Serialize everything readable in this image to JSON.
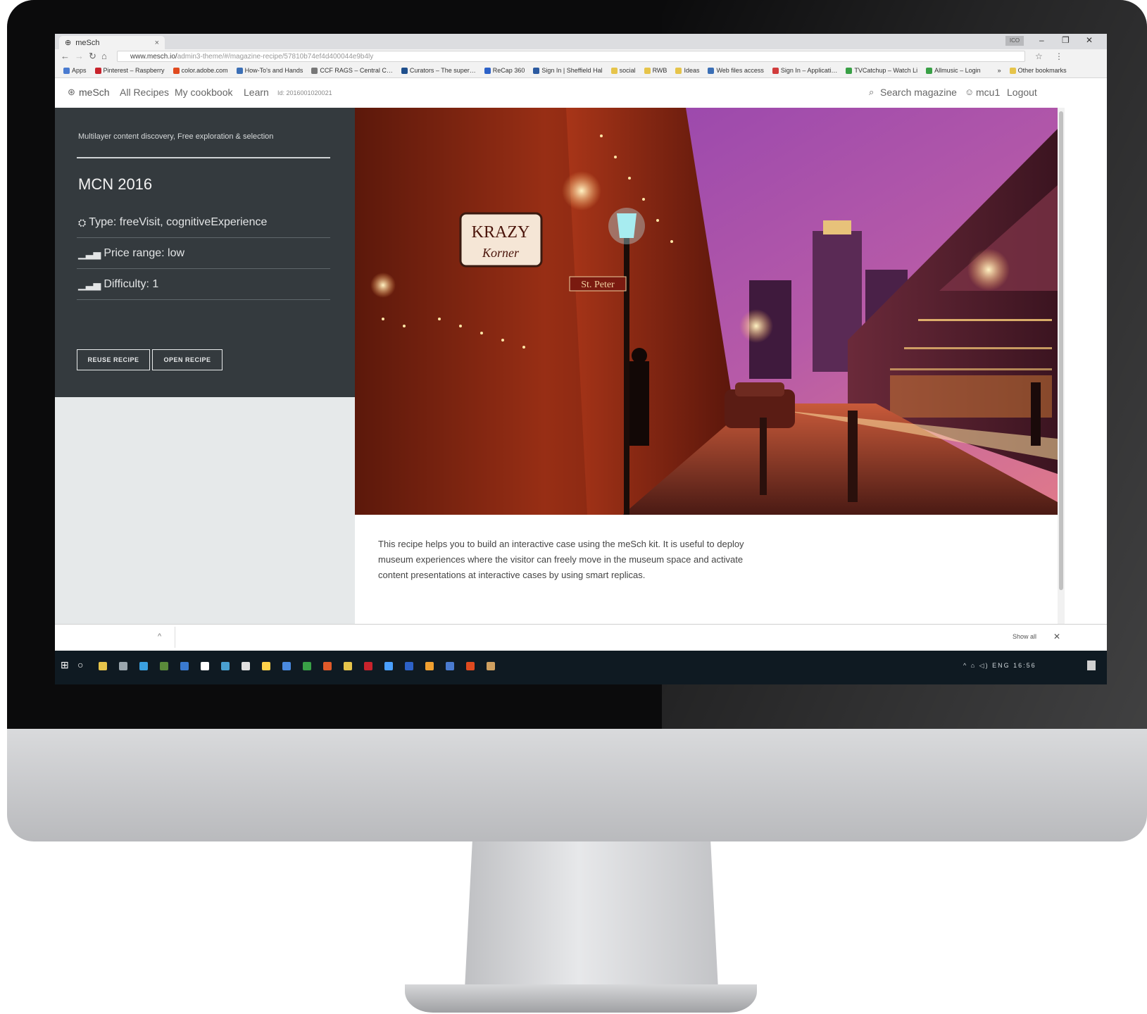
{
  "browser": {
    "tab_title": "meSch",
    "tab_close": "×",
    "window_badge": "ICO",
    "window_minimize": "–",
    "window_restore": "❐",
    "window_close": "✕",
    "url_main": "www.mesch.io/",
    "url_tail": "admin3-theme/#/magazine-recipe/57810b74ef4d400044e9b4ly",
    "bookmarks": [
      {
        "label": "Apps",
        "color": "#4a7bd0"
      },
      {
        "label": "Pinterest – Raspberry",
        "color": "#c8232c"
      },
      {
        "label": "color.adobe.com",
        "color": "#e04a1f"
      },
      {
        "label": "How-To's and Hands",
        "color": "#3b6fb6"
      },
      {
        "label": "CCF RAGS – Central C…",
        "color": "#777777"
      },
      {
        "label": "Curators – The super…",
        "color": "#1f4f8c"
      },
      {
        "label": "ReCap 360",
        "color": "#2d62c8"
      },
      {
        "label": "Sign In | Sheffield Hal",
        "color": "#2c5aa0"
      },
      {
        "label": "social",
        "color": "#e6c44a"
      },
      {
        "label": "RWB",
        "color": "#e6c44a"
      },
      {
        "label": "Ideas",
        "color": "#e6c44a"
      },
      {
        "label": "Web files access",
        "color": "#3b6fb6"
      },
      {
        "label": "Sign In – Applicati…",
        "color": "#d13c3c"
      },
      {
        "label": "TVCatchup – Watch Li",
        "color": "#39a046"
      },
      {
        "label": "Allmusic – Login",
        "color": "#39a046"
      },
      {
        "label": "»",
        "color": "transparent"
      },
      {
        "label": "Other bookmarks",
        "color": "#e6c44a"
      }
    ]
  },
  "site_nav": {
    "brand": "meSch",
    "all_recipes": "All Recipes",
    "my_cookbook": "My cookbook",
    "learn": "Learn",
    "id_text": "Id: 2016001020021",
    "search": "Search magazine",
    "user": "mcu1",
    "logout": "Logout"
  },
  "recipe": {
    "subtitle": "Multilayer content discovery, Free exploration & selection",
    "title": "MCN 2016",
    "type": "Type: freeVisit, cognitiveExperience",
    "price": "Price range: low",
    "difficulty": "Difficulty: 1",
    "reuse_label": "REUSE RECIPE",
    "open_label": "OPEN RECIPE",
    "description": "This recipe helps you to build an interactive case using the meSch kit. It is useful to deploy museum experiences where the visitor can freely move in the museum space and activate content presentations at interactive cases by using smart replicas."
  },
  "hero": {
    "sign_line1": "KRAZY",
    "sign_line2": "Korner",
    "street_sign": "St. Peter"
  },
  "downloads": {
    "chevron": "^",
    "show_all": "Show all",
    "close": "✕"
  },
  "taskbar": {
    "tray_text": "^ ⌂ ◁) ENG 16:56"
  }
}
